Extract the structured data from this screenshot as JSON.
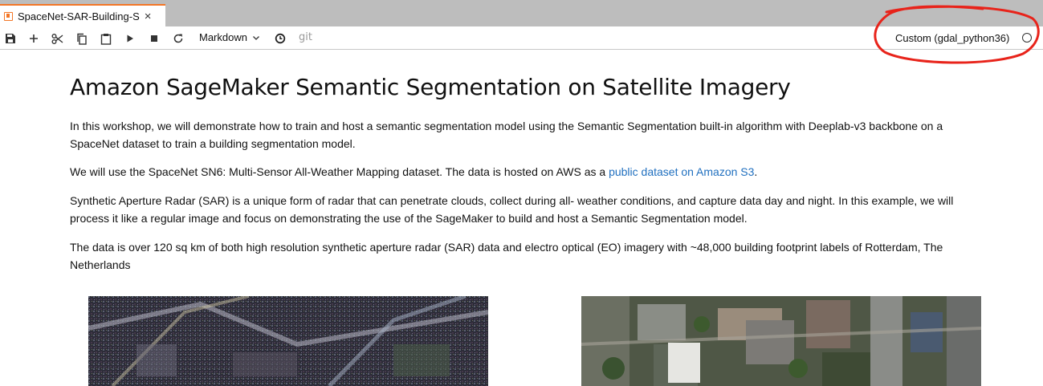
{
  "tab": {
    "title": "SpaceNet-SAR-Building-S",
    "close_glyph": "×",
    "icon": "notebook-icon",
    "accent": "#f37626"
  },
  "toolbar": {
    "buttons": [
      {
        "name": "save-icon"
      },
      {
        "name": "add-cell-icon"
      },
      {
        "name": "cut-icon"
      },
      {
        "name": "copy-icon"
      },
      {
        "name": "paste-icon"
      },
      {
        "name": "run-icon"
      },
      {
        "name": "stop-icon"
      },
      {
        "name": "restart-icon"
      }
    ],
    "cell_type": "Markdown",
    "git_label": "git",
    "kernel_name": "Custom (gdal_python36)",
    "annotation_color": "#e8231a"
  },
  "notebook": {
    "heading": "Amazon SageMaker Semantic Segmentation on Satellite Imagery",
    "p1": "In this workshop, we will demonstrate how to train and host a semantic segmentation model using the Semantic Segmentation built-in algorithm with Deeplab-v3 backbone on a SpaceNet dataset to train a building segmentation model.",
    "p2_before": "We will use the SpaceNet SN6: Multi-Sensor All-Weather Mapping dataset. The data is hosted on AWS as a ",
    "p2_link": "public dataset on Amazon S3",
    "p2_after": ".",
    "p3": "Synthetic Aperture Radar (SAR) is a unique form of radar that can penetrate clouds, collect during all- weather conditions, and capture data day and night. In this example, we will process it like a regular image and focus on demonstrating the use of the SageMaker to build and host a Semantic Segmentation model.",
    "p4": "The data is over 120 sq km of both high resolution synthetic aperture radar (SAR) data and electro optical (EO) imagery with ~48,000 building footprint labels of Rotterdam, The Netherlands",
    "link_color": "#1f6fbf"
  }
}
